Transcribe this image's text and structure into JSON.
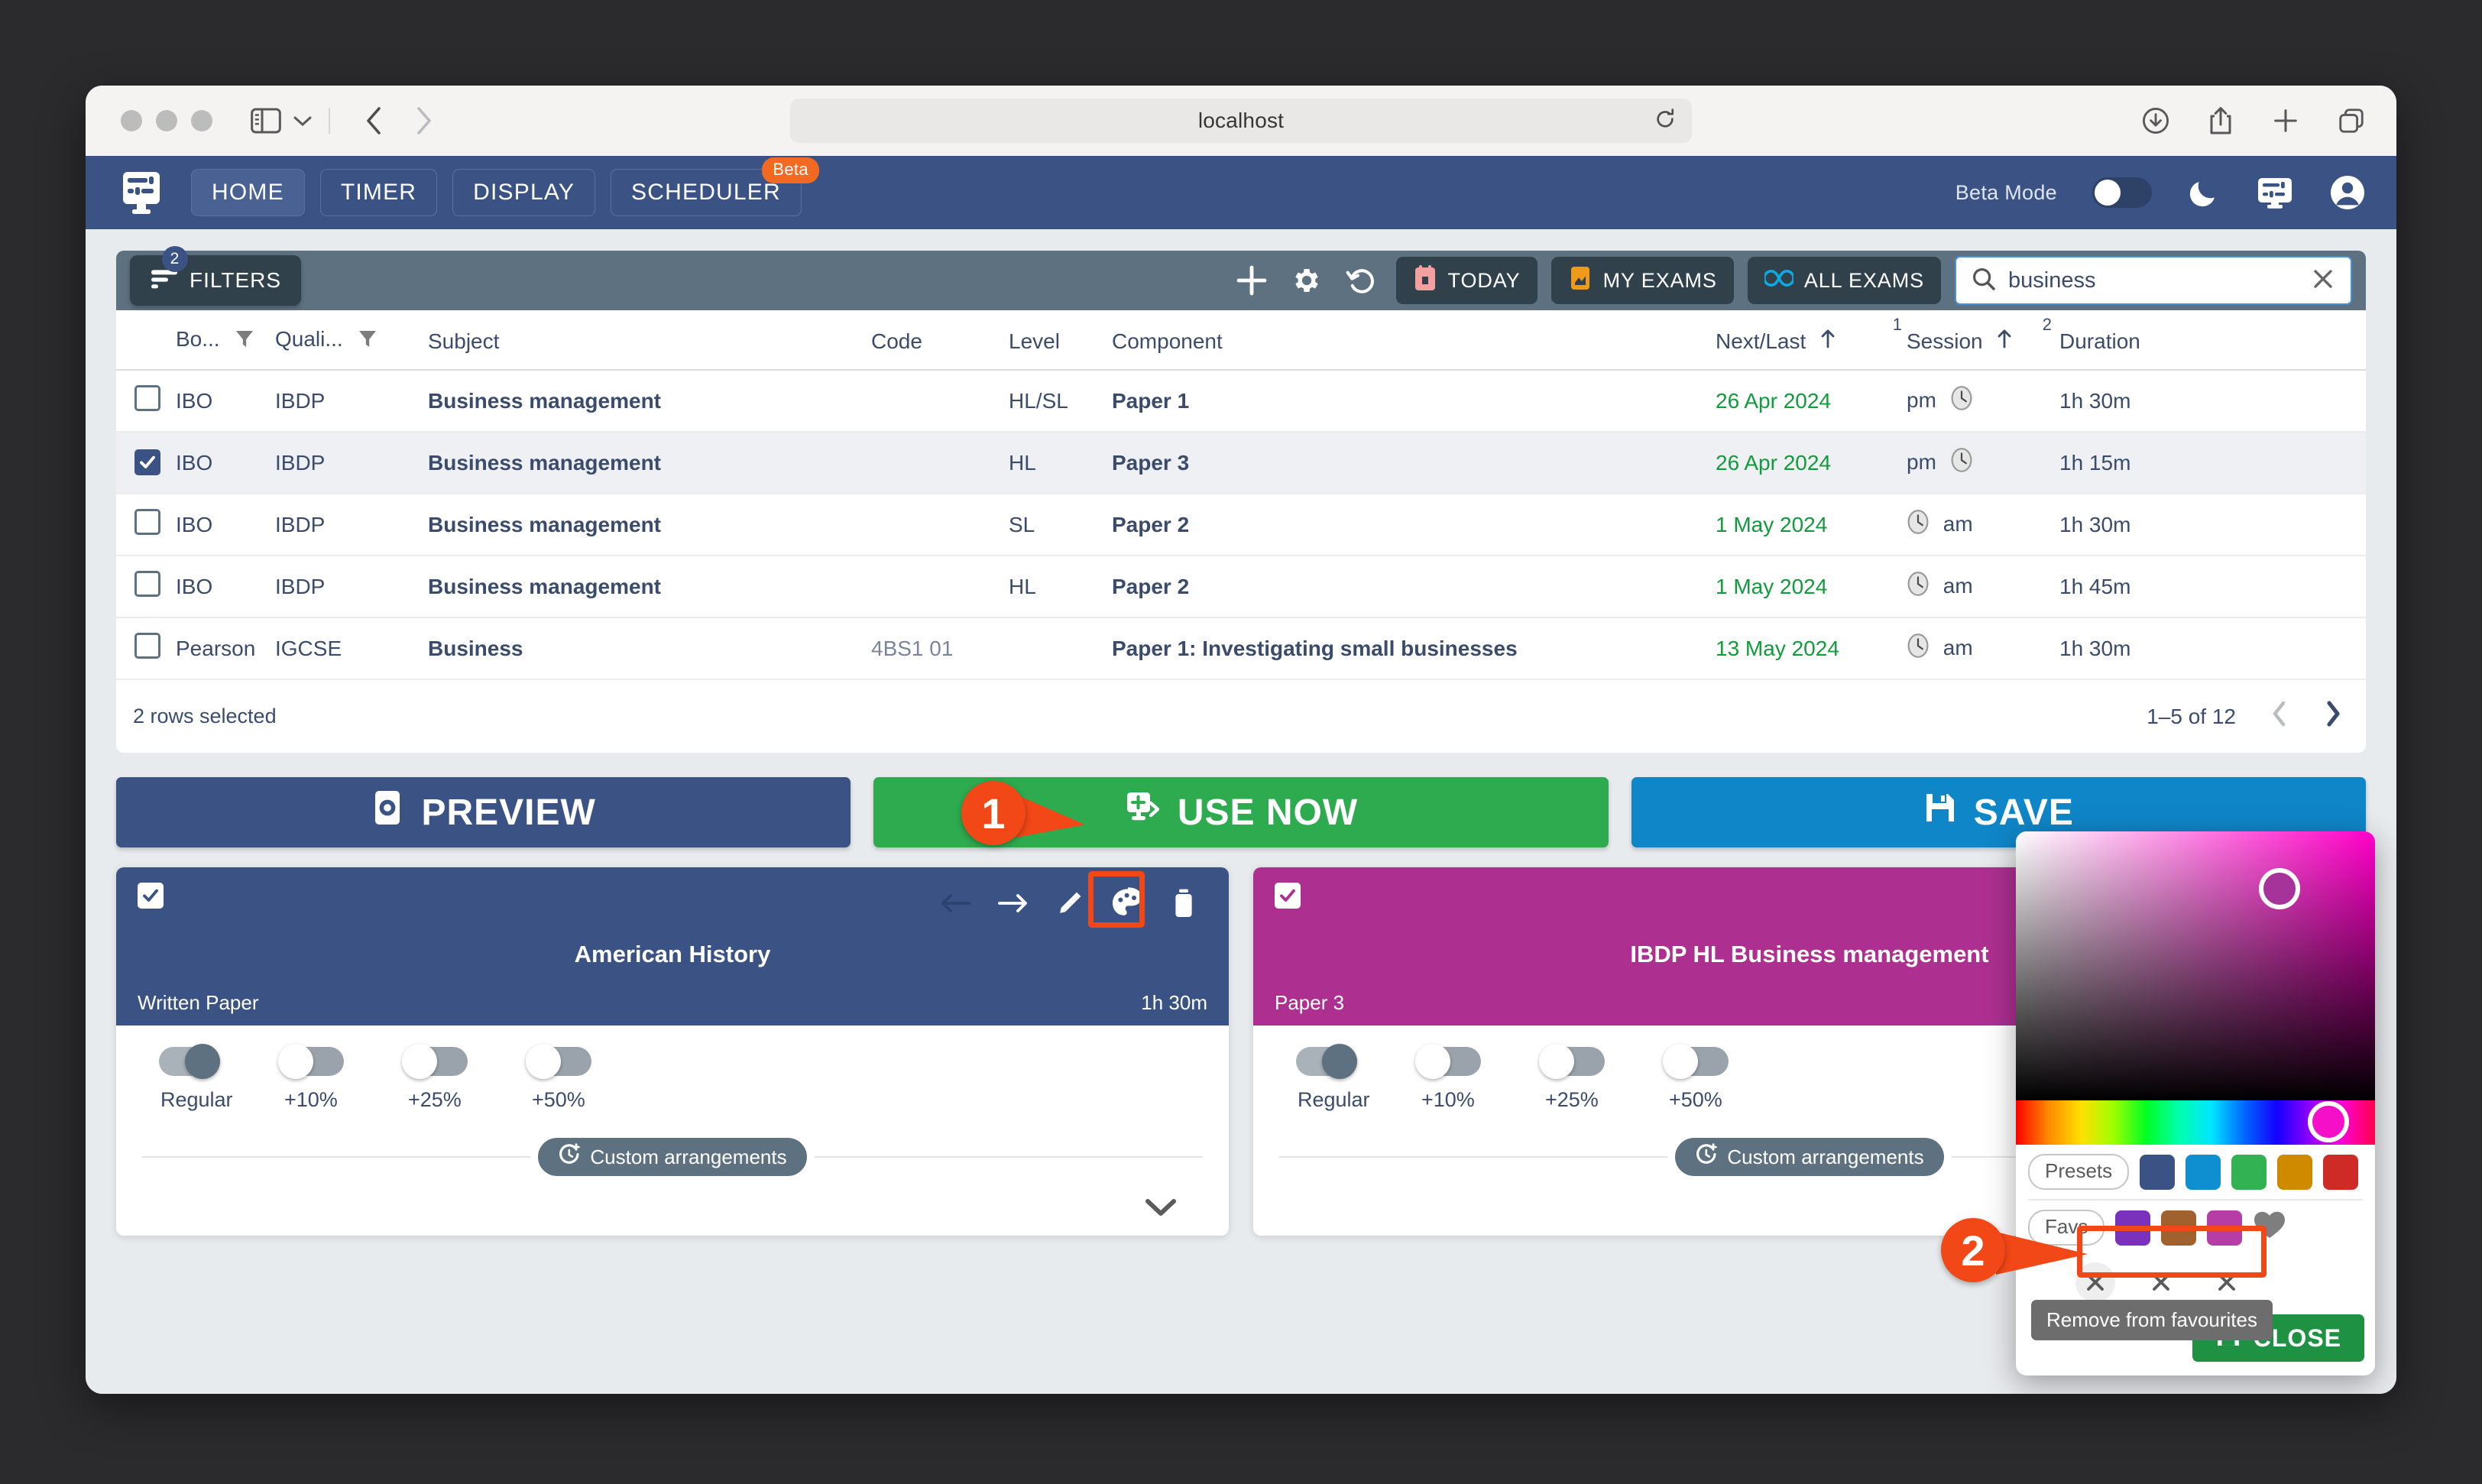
{
  "browser": {
    "url": "localhost",
    "icons": [
      "sidebar-icon",
      "back-icon",
      "forward-icon",
      "reload-icon",
      "downloads-icon",
      "share-icon",
      "new-tab-icon",
      "tab-overview-icon"
    ]
  },
  "header": {
    "logo": "display-settings-icon",
    "tabs": [
      {
        "label": "HOME",
        "active": true,
        "badge": null
      },
      {
        "label": "TIMER",
        "active": false,
        "badge": null
      },
      {
        "label": "DISPLAY",
        "active": false,
        "badge": null
      },
      {
        "label": "SCHEDULER",
        "active": false,
        "badge": "Beta"
      }
    ],
    "beta_mode_label": "Beta Mode",
    "beta_mode_on": false,
    "right_icons": [
      "dark-mode-icon",
      "display-settings-icon",
      "account-icon"
    ]
  },
  "toolbar": {
    "filters_label": "FILTERS",
    "filters_count": "2",
    "add_label": "+",
    "icons": [
      "add-icon",
      "settings-gear-icon",
      "reset-icon"
    ],
    "chips": [
      {
        "label": "TODAY",
        "icon": "today-icon"
      },
      {
        "label": "MY EXAMS",
        "icon": "my-exams-icon"
      },
      {
        "label": "ALL EXAMS",
        "icon": "infinity-icon"
      }
    ],
    "search": {
      "value": "business",
      "placeholder": "Search"
    }
  },
  "table": {
    "columns": [
      "Bo...",
      "Quali...",
      "Subject",
      "Code",
      "Level",
      "Component",
      "Next/Last",
      "Session",
      "Duration"
    ],
    "sort_markers": {
      "next_last": "1",
      "session": "2"
    },
    "rows": [
      {
        "selected": false,
        "board": "IBO",
        "qualification": "IBDP",
        "subject": "Business management",
        "code": "",
        "level": "HL/SL",
        "component": "Paper 1",
        "next_last": "26 Apr 2024",
        "session": "pm",
        "session_icon_side": "right",
        "duration": "1h 30m"
      },
      {
        "selected": true,
        "board": "IBO",
        "qualification": "IBDP",
        "subject": "Business management",
        "code": "",
        "level": "HL",
        "component": "Paper 3",
        "next_last": "26 Apr 2024",
        "session": "pm",
        "session_icon_side": "right",
        "duration": "1h 15m"
      },
      {
        "selected": false,
        "board": "IBO",
        "qualification": "IBDP",
        "subject": "Business management",
        "code": "",
        "level": "SL",
        "component": "Paper 2",
        "next_last": "1 May 2024",
        "session": "am",
        "session_icon_side": "left",
        "duration": "1h 30m"
      },
      {
        "selected": false,
        "board": "IBO",
        "qualification": "IBDP",
        "subject": "Business management",
        "code": "",
        "level": "HL",
        "component": "Paper 2",
        "next_last": "1 May 2024",
        "session": "am",
        "session_icon_side": "left",
        "duration": "1h 45m"
      },
      {
        "selected": false,
        "board": "Pearson",
        "qualification": "IGCSE",
        "subject": "Business",
        "code": "4BS1 01",
        "level": "",
        "component": "Paper 1: Investigating small businesses",
        "next_last": "13 May 2024",
        "session": "am",
        "session_icon_side": "left",
        "duration": "1h 30m"
      }
    ],
    "footer": {
      "selection": "2 rows selected",
      "range": "1–5 of 12"
    }
  },
  "actions": [
    {
      "label": "PREVIEW",
      "icon": "preview-eye-icon",
      "color": "#3a5384"
    },
    {
      "label": "USE NOW",
      "icon": "use-now-icon",
      "color": "#2eaa4f"
    },
    {
      "label": "SAVE",
      "icon": "save-disk-icon",
      "color": "#0f86c8"
    }
  ],
  "cards": [
    {
      "checked": true,
      "color": "#3a5384",
      "title": "American History",
      "subtitle_left": "Written Paper",
      "subtitle_right": "1h 30m",
      "icons": [
        "arrow-left-icon",
        "arrow-right-icon",
        "edit-pencil-icon",
        "palette-icon",
        "delete-trash-icon"
      ],
      "toggles": [
        {
          "label": "Regular",
          "on": true
        },
        {
          "label": "+10%",
          "on": false
        },
        {
          "label": "+25%",
          "on": false
        },
        {
          "label": "+50%",
          "on": false
        }
      ],
      "custom_label": "Custom arrangements"
    },
    {
      "checked": true,
      "color": "#ad3090",
      "title": "IBDP HL Business management",
      "subtitle_left": "Paper 3",
      "subtitle_right": "",
      "icons": [],
      "toggles": [
        {
          "label": "Regular",
          "on": true
        },
        {
          "label": "+10%",
          "on": false
        },
        {
          "label": "+25%",
          "on": false
        },
        {
          "label": "+50%",
          "on": false
        }
      ],
      "custom_label": "Custom arrangements"
    }
  ],
  "picker": {
    "selected_color": "#a5339a",
    "hue_color": "#f50fc8",
    "presets_label": "Presets",
    "favs_label": "Favs",
    "presets": [
      "#3a5384",
      "#0f8fd0",
      "#33b253",
      "#d08a00",
      "#cf2b26"
    ],
    "favs": [
      "#7a32bd",
      "#a1612f",
      "#b63ca6"
    ],
    "heart_icon": "heart-icon",
    "remove_buttons": [
      "remove-fav-1",
      "remove-fav-2",
      "remove-fav-3"
    ],
    "tooltip": "Remove from favourites",
    "close_label": "CLOSE",
    "close_icon": "save-disk-icon"
  },
  "callouts": [
    {
      "number": "1"
    },
    {
      "number": "2"
    }
  ]
}
